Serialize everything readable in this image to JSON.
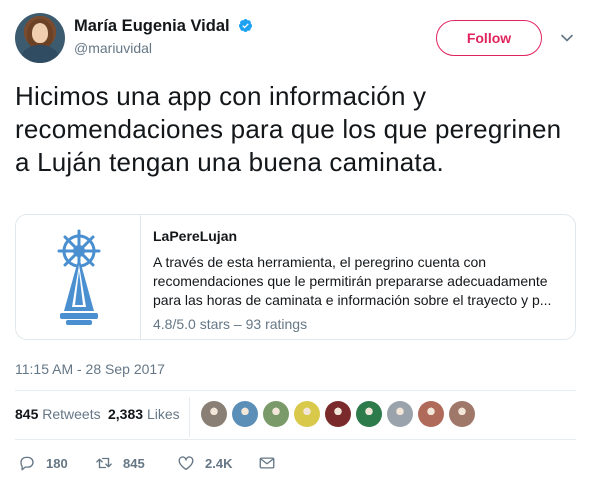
{
  "user": {
    "display_name": "María Eugenia Vidal",
    "handle": "@mariuvidal",
    "verified": true,
    "avatar_icon": "profile-photo"
  },
  "follow_button": {
    "label": "Follow",
    "color": "#e0245e"
  },
  "menu_icon": "chevron-down-icon",
  "tweet": {
    "text": "Hicimos una app con información y recomendaciones para que los que peregrinen a Luján tengan una buena caminata."
  },
  "card": {
    "image_icon": "lujan-basilica-logo",
    "image_color": "#4a90d0",
    "title": "LaPereLujan",
    "description": "A través de esta herramienta, el peregrino cuenta con recomendaciones que le permitirán prepararse adecuadamente para las horas de caminata e información sobre el trayecto y p...",
    "rating": "4.8/5.0 stars – 93 ratings"
  },
  "timestamp": "11:15 AM - 28 Sep 2017",
  "stats": {
    "retweets_count": "845",
    "retweets_label": "Retweets",
    "likes_count": "2,383",
    "likes_label": "Likes"
  },
  "likers": [
    {
      "icon": "liker-avatar",
      "color": "#8a7f75"
    },
    {
      "icon": "liker-avatar",
      "color": "#5c8fb8"
    },
    {
      "icon": "liker-avatar",
      "color": "#7a9a6a"
    },
    {
      "icon": "liker-avatar",
      "color": "#d9c94a"
    },
    {
      "icon": "liker-avatar",
      "color": "#7a2a2a"
    },
    {
      "icon": "liker-avatar",
      "color": "#2d7a4a"
    },
    {
      "icon": "liker-avatar",
      "color": "#9aa3ab"
    },
    {
      "icon": "liker-avatar",
      "color": "#b06a5a"
    },
    {
      "icon": "liker-avatar",
      "color": "#a0786a"
    }
  ],
  "actions": {
    "reply_count": "180",
    "retweet_count": "845",
    "like_count": "2.4K"
  },
  "colors": {
    "text": "#14171a",
    "secondary": "#657786",
    "border": "#e1e8ed",
    "verified": "#1da1f2"
  }
}
